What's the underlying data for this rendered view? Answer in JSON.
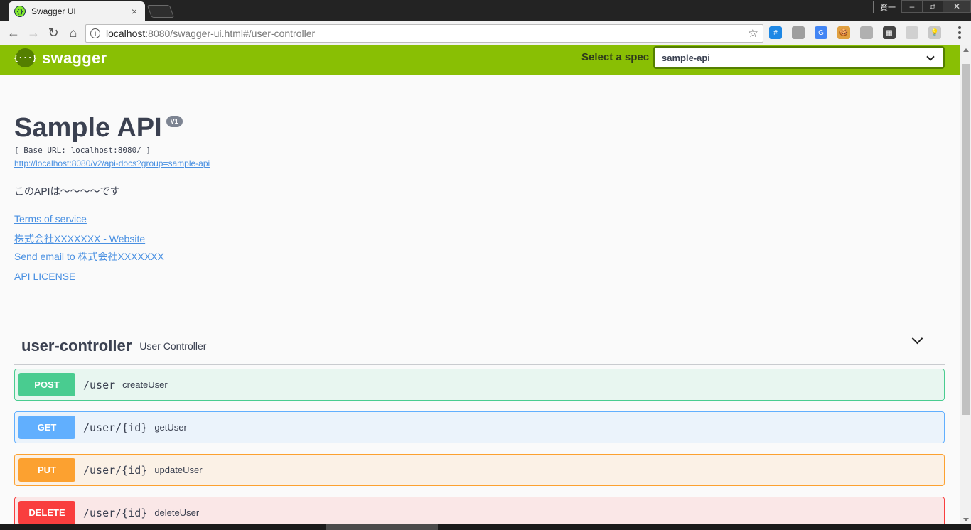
{
  "browser": {
    "tab_title": "Swagger UI",
    "tab_close": "×",
    "url_host": "localhost",
    "url_rest": ":8080/swagger-ui.html#/user-controller",
    "user_badge": "賢一",
    "win_minimize": "–",
    "win_restore": "⧉",
    "win_close": "✕",
    "nav_back": "←",
    "nav_forward": "→",
    "nav_reload": "↻",
    "nav_home": "⌂",
    "star": "☆",
    "info": "i",
    "extensions": [
      {
        "icon": "hash-extension-icon",
        "glyph": "#",
        "color": "#1e88e5"
      },
      {
        "icon": "circle-extension-icon",
        "glyph": "",
        "color": "#9e9e9e"
      },
      {
        "icon": "translate-extension-icon",
        "glyph": "G",
        "color": "#4285f4"
      },
      {
        "icon": "cookie-extension-icon",
        "glyph": "🍪",
        "color": "#e0a040"
      },
      {
        "icon": "card-extension-icon",
        "glyph": "",
        "color": "#b0b0b0"
      },
      {
        "icon": "qr-code-extension-icon",
        "glyph": "▦",
        "color": "#444444"
      },
      {
        "icon": "document-extension-icon",
        "glyph": "",
        "color": "#d0d0d0"
      },
      {
        "icon": "lightbulb-extension-icon",
        "glyph": "💡",
        "color": "#c8c8c8"
      }
    ]
  },
  "topbar": {
    "logo_glyph": "{···}",
    "logo_text": "swagger",
    "spec_label": "Select a spec",
    "spec_selected": "sample-api",
    "accent": "#89bf04"
  },
  "info": {
    "title": "Sample API",
    "version": "V1",
    "base_url": "[ Base URL: localhost:8080/ ]",
    "api_docs_url": "http://localhost:8080/v2/api-docs?group=sample-api",
    "description": "このAPIは～～～～です",
    "terms": "Terms of service",
    "website": "株式会社XXXXXXX - Website",
    "email": "Send email to 株式会社XXXXXXX",
    "license": "API LICENSE"
  },
  "tag": {
    "name": "user-controller",
    "description": "User Controller"
  },
  "operations": [
    {
      "method": "POST",
      "path": "/user",
      "summary": "createUser",
      "color": "#49cc90"
    },
    {
      "method": "GET",
      "path": "/user/{id}",
      "summary": "getUser",
      "color": "#61affe"
    },
    {
      "method": "PUT",
      "path": "/user/{id}",
      "summary": "updateUser",
      "color": "#fca130"
    },
    {
      "method": "DELETE",
      "path": "/user/{id}",
      "summary": "deleteUser",
      "color": "#f93e3e"
    }
  ]
}
